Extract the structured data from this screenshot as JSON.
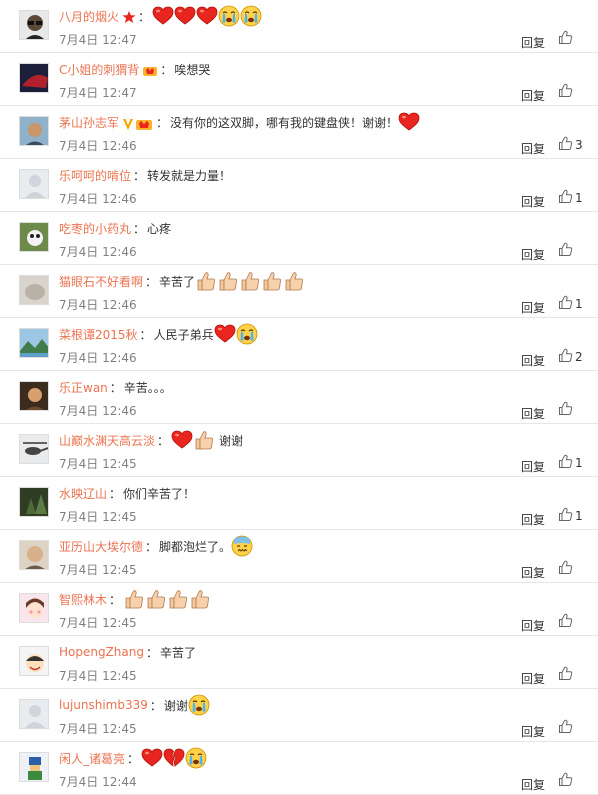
{
  "comments": [
    {
      "user": "八月的烟火",
      "vip_badge": "star-badge",
      "text": "",
      "emojis": [
        "heart",
        "heart",
        "heart",
        "crying",
        "crying"
      ],
      "time": "7月4日 12:47",
      "reply": "回复",
      "likes": "",
      "avatar": "avatar-glasses-man"
    },
    {
      "user": "C小姐的刺猬背",
      "vip_badge": "crown-badge",
      "text": "唉想哭",
      "emojis": [],
      "time": "7月4日 12:47",
      "reply": "回复",
      "likes": "",
      "avatar": "avatar-dark-red"
    },
    {
      "user": "茅山孙志军",
      "vip_badge": "v-crown-badge",
      "text": "没有你的这双脚，哪有我的键盘侠！谢谢！",
      "emojis": [
        "heart"
      ],
      "time": "7月4日 12:46",
      "reply": "回复",
      "likes": "3",
      "avatar": "avatar-man-outdoor"
    },
    {
      "user": "乐呵呵的啃位",
      "vip_badge": "",
      "text": "转发就是力量！",
      "emojis": [],
      "time": "7月4日 12:46",
      "reply": "回复",
      "likes": "1",
      "avatar": "avatar-default"
    },
    {
      "user": "吃枣的小药丸",
      "vip_badge": "",
      "text": "心疼",
      "emojis": [],
      "time": "7月4日 12:46",
      "reply": "回复",
      "likes": "",
      "avatar": "avatar-panda"
    },
    {
      "user": "猫眼石不好看啊",
      "vip_badge": "",
      "text": "辛苦了",
      "emojis": [
        "thumb",
        "thumb",
        "thumb",
        "thumb",
        "thumb"
      ],
      "time": "7月4日 12:46",
      "reply": "回复",
      "likes": "1",
      "avatar": "avatar-stone"
    },
    {
      "user": "菜根谭2015秋",
      "vip_badge": "",
      "text": "人民子弟兵",
      "emojis": [
        "heart",
        "crying"
      ],
      "time": "7月4日 12:46",
      "reply": "回复",
      "likes": "2",
      "avatar": "avatar-landscape"
    },
    {
      "user": "乐正wan",
      "vip_badge": "",
      "text": "辛苦。。。",
      "emojis": [],
      "time": "7月4日 12:46",
      "reply": "回复",
      "likes": "",
      "avatar": "avatar-portrait"
    },
    {
      "user": "山巅水渊天高云淡",
      "vip_badge": "",
      "text": "谢谢",
      "text_after_emoji": true,
      "emojis": [
        "heart",
        "thumb"
      ],
      "time": "7月4日 12:45",
      "reply": "回复",
      "likes": "1",
      "avatar": "avatar-helicopter"
    },
    {
      "user": "水映辽山",
      "vip_badge": "",
      "text": "你们辛苦了！",
      "emojis": [],
      "time": "7月4日 12:45",
      "reply": "回复",
      "likes": "1",
      "avatar": "avatar-forest"
    },
    {
      "user": "亚历山大埃尔德",
      "vip_badge": "",
      "text": "脚都泡烂了。",
      "emojis": [
        "sweat"
      ],
      "time": "7月4日 12:45",
      "reply": "回复",
      "likes": "",
      "avatar": "avatar-bald-man"
    },
    {
      "user": "智熙林木",
      "vip_badge": "",
      "text": "",
      "emojis": [
        "thumb",
        "thumb",
        "thumb",
        "thumb"
      ],
      "time": "7月4日 12:45",
      "reply": "回复",
      "likes": "",
      "avatar": "avatar-cartoon-girl"
    },
    {
      "user": "HopengZhang",
      "vip_badge": "",
      "text": "辛苦了",
      "emojis": [],
      "time": "7月4日 12:45",
      "reply": "回复",
      "likes": "",
      "avatar": "avatar-cartoon-boy"
    },
    {
      "user": "lujunshimb339",
      "vip_badge": "",
      "text": "谢谢",
      "emojis": [
        "crying"
      ],
      "time": "7月4日 12:45",
      "reply": "回复",
      "likes": "",
      "avatar": "avatar-default"
    },
    {
      "user": "闲人_诸葛亮",
      "vip_badge": "",
      "text": "",
      "emojis": [
        "heart",
        "broken-heart",
        "crying"
      ],
      "time": "7月4日 12:44",
      "reply": "回复",
      "likes": "",
      "avatar": "avatar-pixel"
    }
  ],
  "colors": {
    "username": "#eb7350",
    "time": "#808080",
    "border": "#e6e6e6"
  }
}
